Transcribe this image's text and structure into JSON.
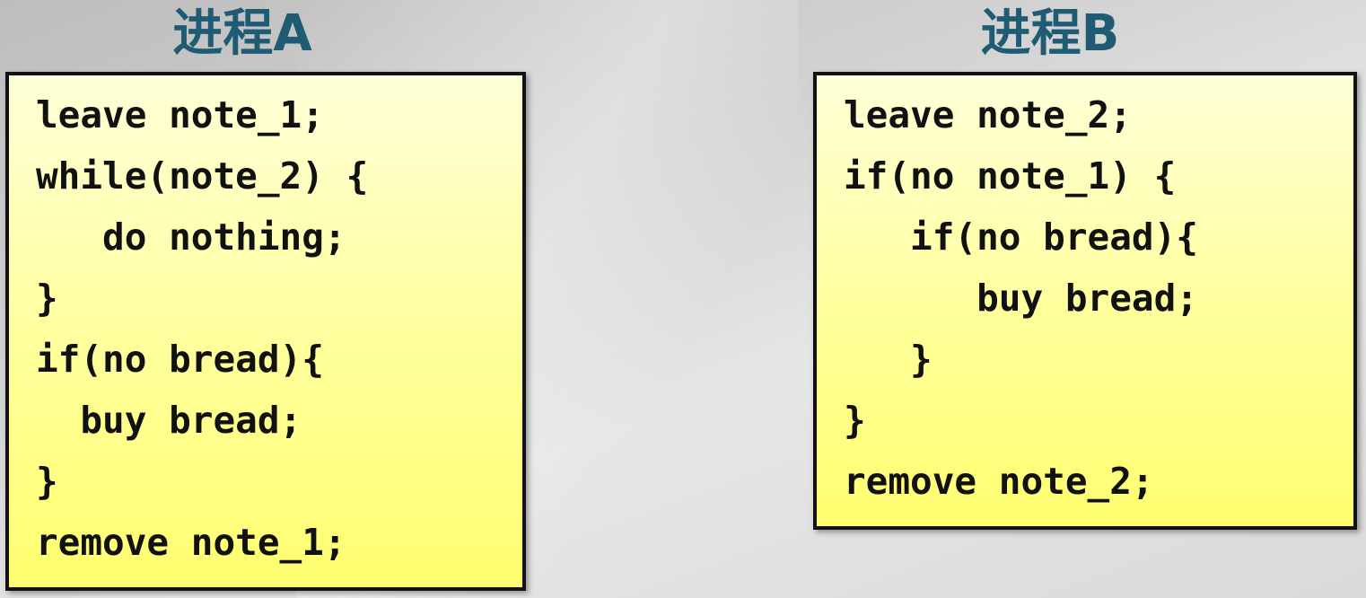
{
  "process_a": {
    "title": "进程A",
    "lines": [
      "leave note_1;",
      "while(note_2) {",
      "   do nothing;",
      "}",
      "if(no bread){",
      "  buy bread;",
      "}",
      "remove note_1;"
    ]
  },
  "process_b": {
    "title": "进程B",
    "lines": [
      "leave note_2;",
      "if(no note_1) {",
      "   if(no bread){",
      "      buy bread;",
      "   }",
      "}",
      "remove note_2;"
    ]
  }
}
